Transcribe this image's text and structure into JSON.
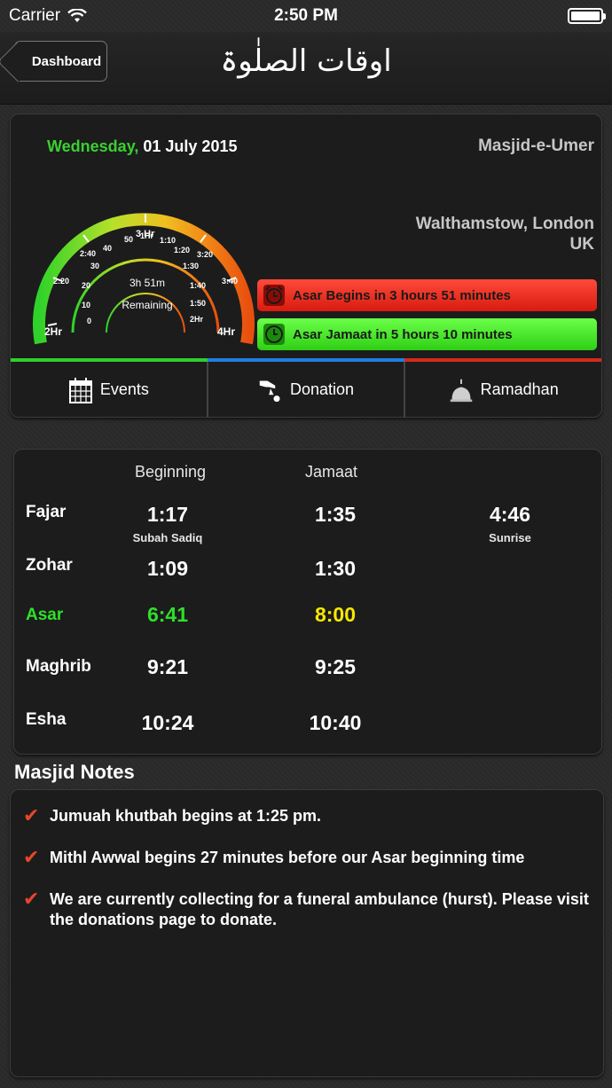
{
  "status": {
    "carrier": "Carrier",
    "time": "2:50 PM"
  },
  "nav": {
    "back_label": "Dashboard",
    "title": "اوقات الصلٰوۃ"
  },
  "header": {
    "day": "Wednesday,",
    "date": "01 July 2015",
    "masjid": "Masjid-e-Umer",
    "city": "Walthamstow, London",
    "country": "UK"
  },
  "gauge": {
    "remaining_time": "3h 51m",
    "remaining_label": "Remaining",
    "outer_labels": [
      "2Hr",
      "2:20",
      "2:40",
      "3 Hr",
      "3:20",
      "3:40",
      "4Hr"
    ],
    "mid_labels": [
      "0",
      "10",
      "20",
      "30",
      "40",
      "50",
      "1Hr",
      "1:10",
      "1:20",
      "1:30",
      "1:40",
      "1:50",
      "2Hr"
    ],
    "colors": [
      "#2fd22a",
      "#b6e02a",
      "#f0c020",
      "#f07a14",
      "#e8500e"
    ]
  },
  "alerts": {
    "begins": "Asar Begins in 3 hours 51 minutes",
    "jamaat": "Asar Jamaat in 5 hours 10 minutes",
    "red": "#e02a1a",
    "green": "#45e82a"
  },
  "tabs": {
    "events": "Events",
    "donation": "Donation",
    "ramadhan": "Ramadhan",
    "strip_colors": [
      "#2fcf2a",
      "#1e7fe0",
      "#d42a1a"
    ]
  },
  "times": {
    "beginning_header": "Beginning",
    "jamaat_header": "Jamaat",
    "rows": [
      {
        "name": "Fajar",
        "begin": "1:17",
        "begin_sub": "Subah Sadiq",
        "jamaat": "1:35",
        "extra": "4:46",
        "extra_sub": "Sunrise"
      },
      {
        "name": "Zohar",
        "begin": "1:09",
        "jamaat": "1:30"
      },
      {
        "name": "Asar",
        "begin": "6:41",
        "jamaat": "8:00"
      },
      {
        "name": "Maghrib",
        "begin": "9:21",
        "jamaat": "9:25"
      },
      {
        "name": "Esha",
        "begin": "10:24",
        "jamaat": "10:40"
      }
    ]
  },
  "notes": {
    "title": "Masjid Notes",
    "items": [
      "Jumuah khutbah begins at 1:25 pm.",
      "Mithl Awwal begins 27 minutes before our Asar beginning time",
      "We are currently collecting for a funeral ambulance (hurst). Please visit the donations page to donate."
    ]
  }
}
